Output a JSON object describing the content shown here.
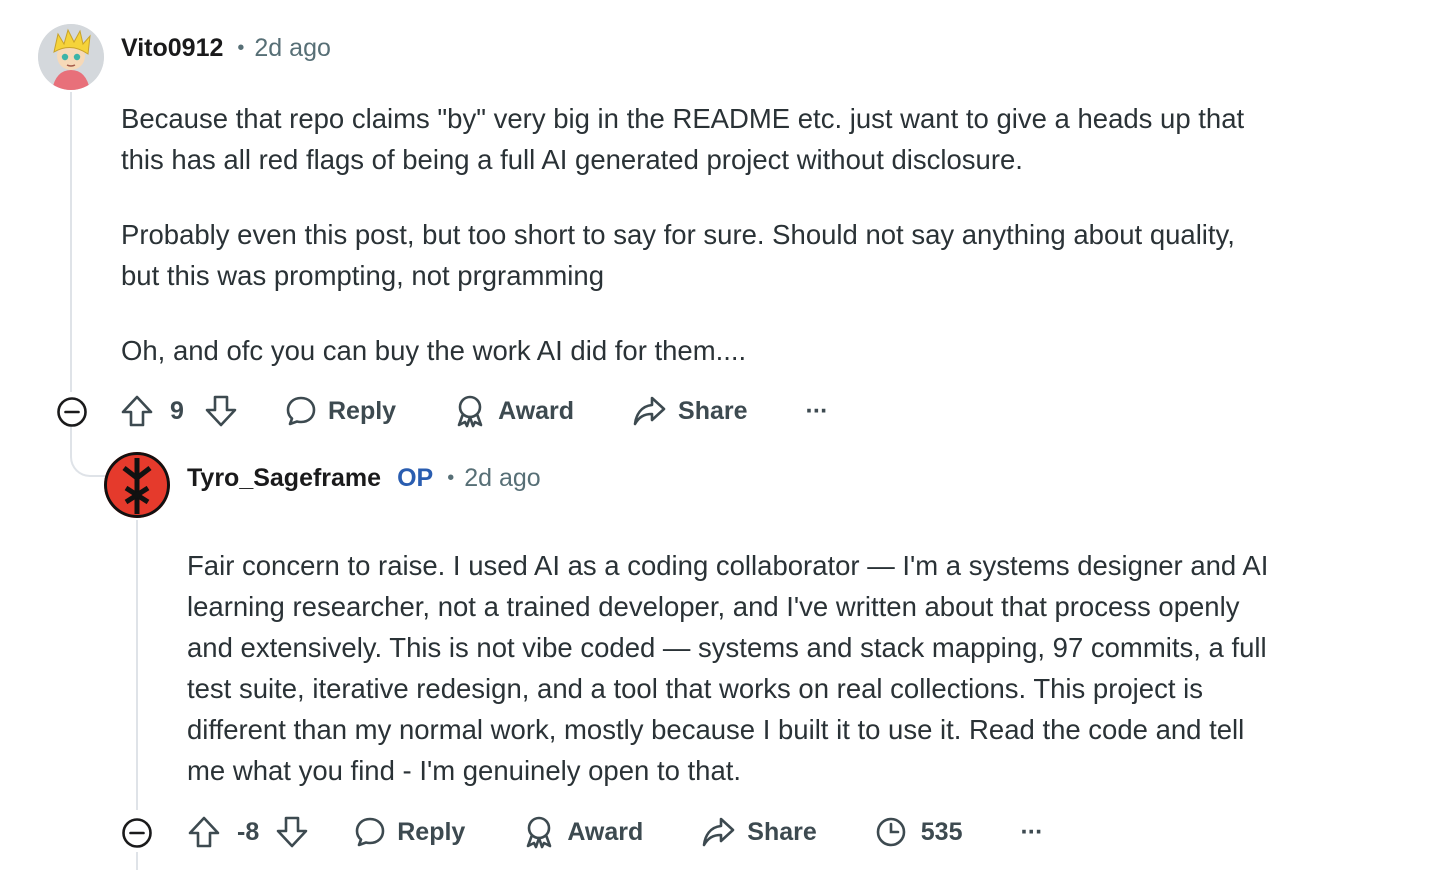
{
  "comment1": {
    "username": "Vito0912",
    "time": "2d ago",
    "paragraphs": [
      [
        "Because that repo claims \"by\" very big in the README etc. just want to give a heads up that",
        "this has all red flags of being a full AI generated project without disclosure."
      ],
      [
        "Probably even this post, but too short to say for sure. Should not say anything about quality,",
        "but this was prompting, not prgramming"
      ],
      [
        "Oh, and ofc you can buy the work AI did for them...."
      ]
    ],
    "votes": "9",
    "reply_label": "Reply",
    "award_label": "Award",
    "share_label": "Share",
    "more_label": "···"
  },
  "comment2": {
    "username": "Tyro_Sageframe",
    "op_badge": "OP",
    "time": "2d ago",
    "lines": [
      "Fair concern to raise. I used AI as a coding collaborator — I'm a systems designer and AI",
      "learning researcher, not a trained developer, and I've written about that process openly",
      "and extensively. This is not vibe coded — systems and stack mapping, 97 commits, a full",
      "test suite, iterative redesign, and a tool that works on real collections. This project is",
      "different than my normal work, mostly because I built it to use it. Read the code and tell",
      "me what you find - I'm genuinely open to that."
    ],
    "votes": "-8",
    "reply_label": "Reply",
    "award_label": "Award",
    "share_label": "Share",
    "views": "535",
    "more_label": "···"
  },
  "colors": {
    "text": "#1a1a1b",
    "meta": "#576f76",
    "op_badge": "#2a5db0",
    "thread_line": "#dfe3e8",
    "avatar2_bg": "#e53a2c"
  },
  "icons": [
    "collapse-icon",
    "upvote-icon",
    "downvote-icon",
    "reply-icon",
    "award-icon",
    "share-icon",
    "views-icon",
    "more-icon"
  ]
}
